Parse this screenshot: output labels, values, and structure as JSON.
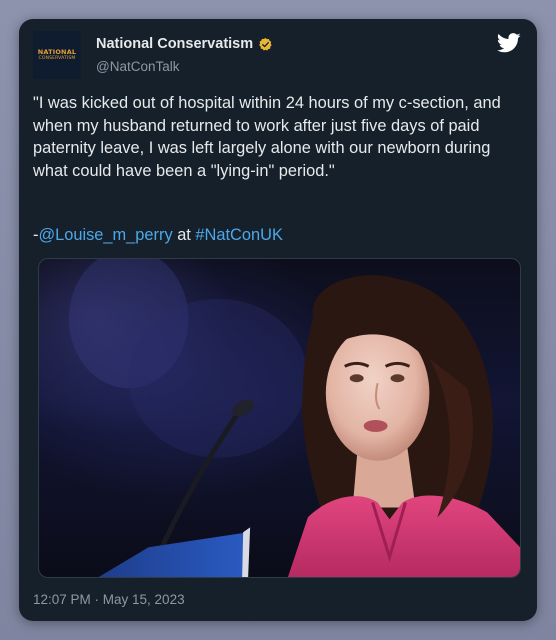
{
  "tweet": {
    "avatar": {
      "line1": "NATIONAL",
      "line2": "CONSERVATISM",
      "accent": "#e2a23a"
    },
    "display_name": "National Conservatism",
    "verified_badge_icon": "verified-gold-badge-icon",
    "handle": "@NatConTalk",
    "platform_icon": "twitter-bird-icon",
    "text": "\"I was kicked out of hospital within 24 hours of my c-section, and when my husband returned to work after just five days of paid paternity leave, I was left largely alone with our newborn during what could have been a \"lying-in\" period.\"",
    "credit_prefix": "-",
    "mention": "@Louise_m_perry",
    "credit_middle": " at ",
    "hashtag": "#NatConUK",
    "media_description_icon": "photo-image",
    "timestamp": "12:07 PM · May 15, 2023"
  },
  "colors": {
    "card_bg": "#15202b",
    "text": "#e7e9ea",
    "muted": "#8b98a5",
    "link": "#4ea7e8",
    "badge": "#e8b534"
  }
}
